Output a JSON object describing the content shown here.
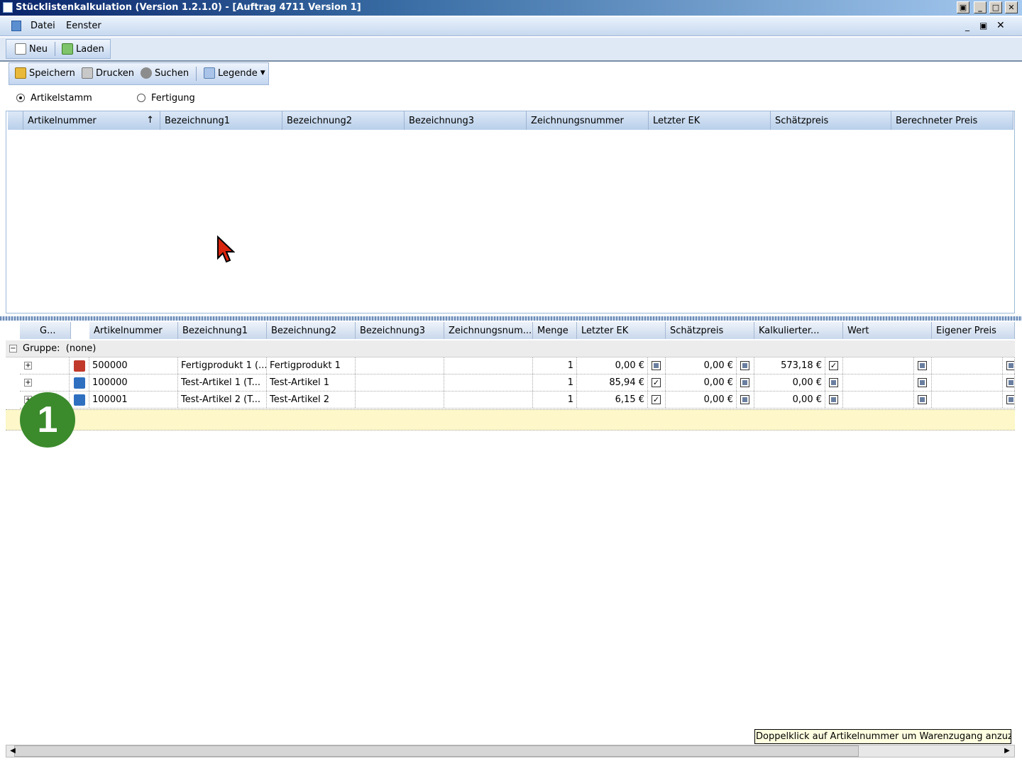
{
  "window": {
    "title": "Stücklistenkalkulation (Version 1.2.1.0) - [Auftrag 4711 Version 1]"
  },
  "menu": {
    "items": [
      "Datei",
      "Eenster"
    ]
  },
  "toolbar1": {
    "new_label": "Neu",
    "load_label": "Laden"
  },
  "toolbar2": {
    "save_label": "Speichern",
    "print_label": "Drucken",
    "search_label": "Suchen",
    "legend_label": "Legende"
  },
  "radios": {
    "option1": "Artikelstamm",
    "option2": "Fertigung",
    "selected": "Artikelstamm"
  },
  "upper_grid": {
    "columns": [
      "Artikelnummer",
      "Bezeichnung1",
      "Bezeichnung2",
      "Bezeichnung3",
      "Zeichnungsnummer",
      "Letzter EK",
      "Schätzpreis",
      "Berechneter Preis"
    ]
  },
  "lower_grid": {
    "columns": [
      "G...",
      "Artikelnummer",
      "Bezeichnung1",
      "Bezeichnung2",
      "Bezeichnung3",
      "Zeichnungsnum...",
      "Menge",
      "Letzter EK",
      "Schätzpreis",
      "Kalkulierter...",
      "Wert",
      "Eigener Preis"
    ],
    "group_label": "Gruppe:  (none)",
    "rows": [
      {
        "artikelnummer": "500000",
        "bez1": "Fertigprodukt 1   (...",
        "bez2": "Fertigprodukt 1",
        "bez3": "",
        "zeichnung": "",
        "menge": "1",
        "letzter_ek": "0,00 €",
        "ek_checked": false,
        "schaetzpreis": "0,00 €",
        "sp_checked": false,
        "kalkuliert": "573,18 €",
        "kalk_checked": true,
        "wert": ""
      },
      {
        "artikelnummer": "100000",
        "bez1": "Test-Artikel 1   (T...",
        "bez2": "Test-Artikel 1",
        "bez3": "",
        "zeichnung": "",
        "menge": "1",
        "letzter_ek": "85,94 €",
        "ek_checked": true,
        "schaetzpreis": "0,00 €",
        "sp_checked": false,
        "kalkuliert": "0,00 €",
        "kalk_checked": false,
        "wert": ""
      },
      {
        "artikelnummer": "100001",
        "bez1": "Test-Artikel 2   (T...",
        "bez2": "Test-Artikel 2",
        "bez3": "",
        "zeichnung": "",
        "menge": "1",
        "letzter_ek": "6,15 €",
        "ek_checked": true,
        "schaetzpreis": "0,00 €",
        "sp_checked": false,
        "kalkuliert": "0,00 €",
        "kalk_checked": false,
        "wert": ""
      }
    ]
  },
  "badge": "1",
  "tooltip": "Doppelklick auf Artikelnummer um Warenzugang anzuzeigen"
}
